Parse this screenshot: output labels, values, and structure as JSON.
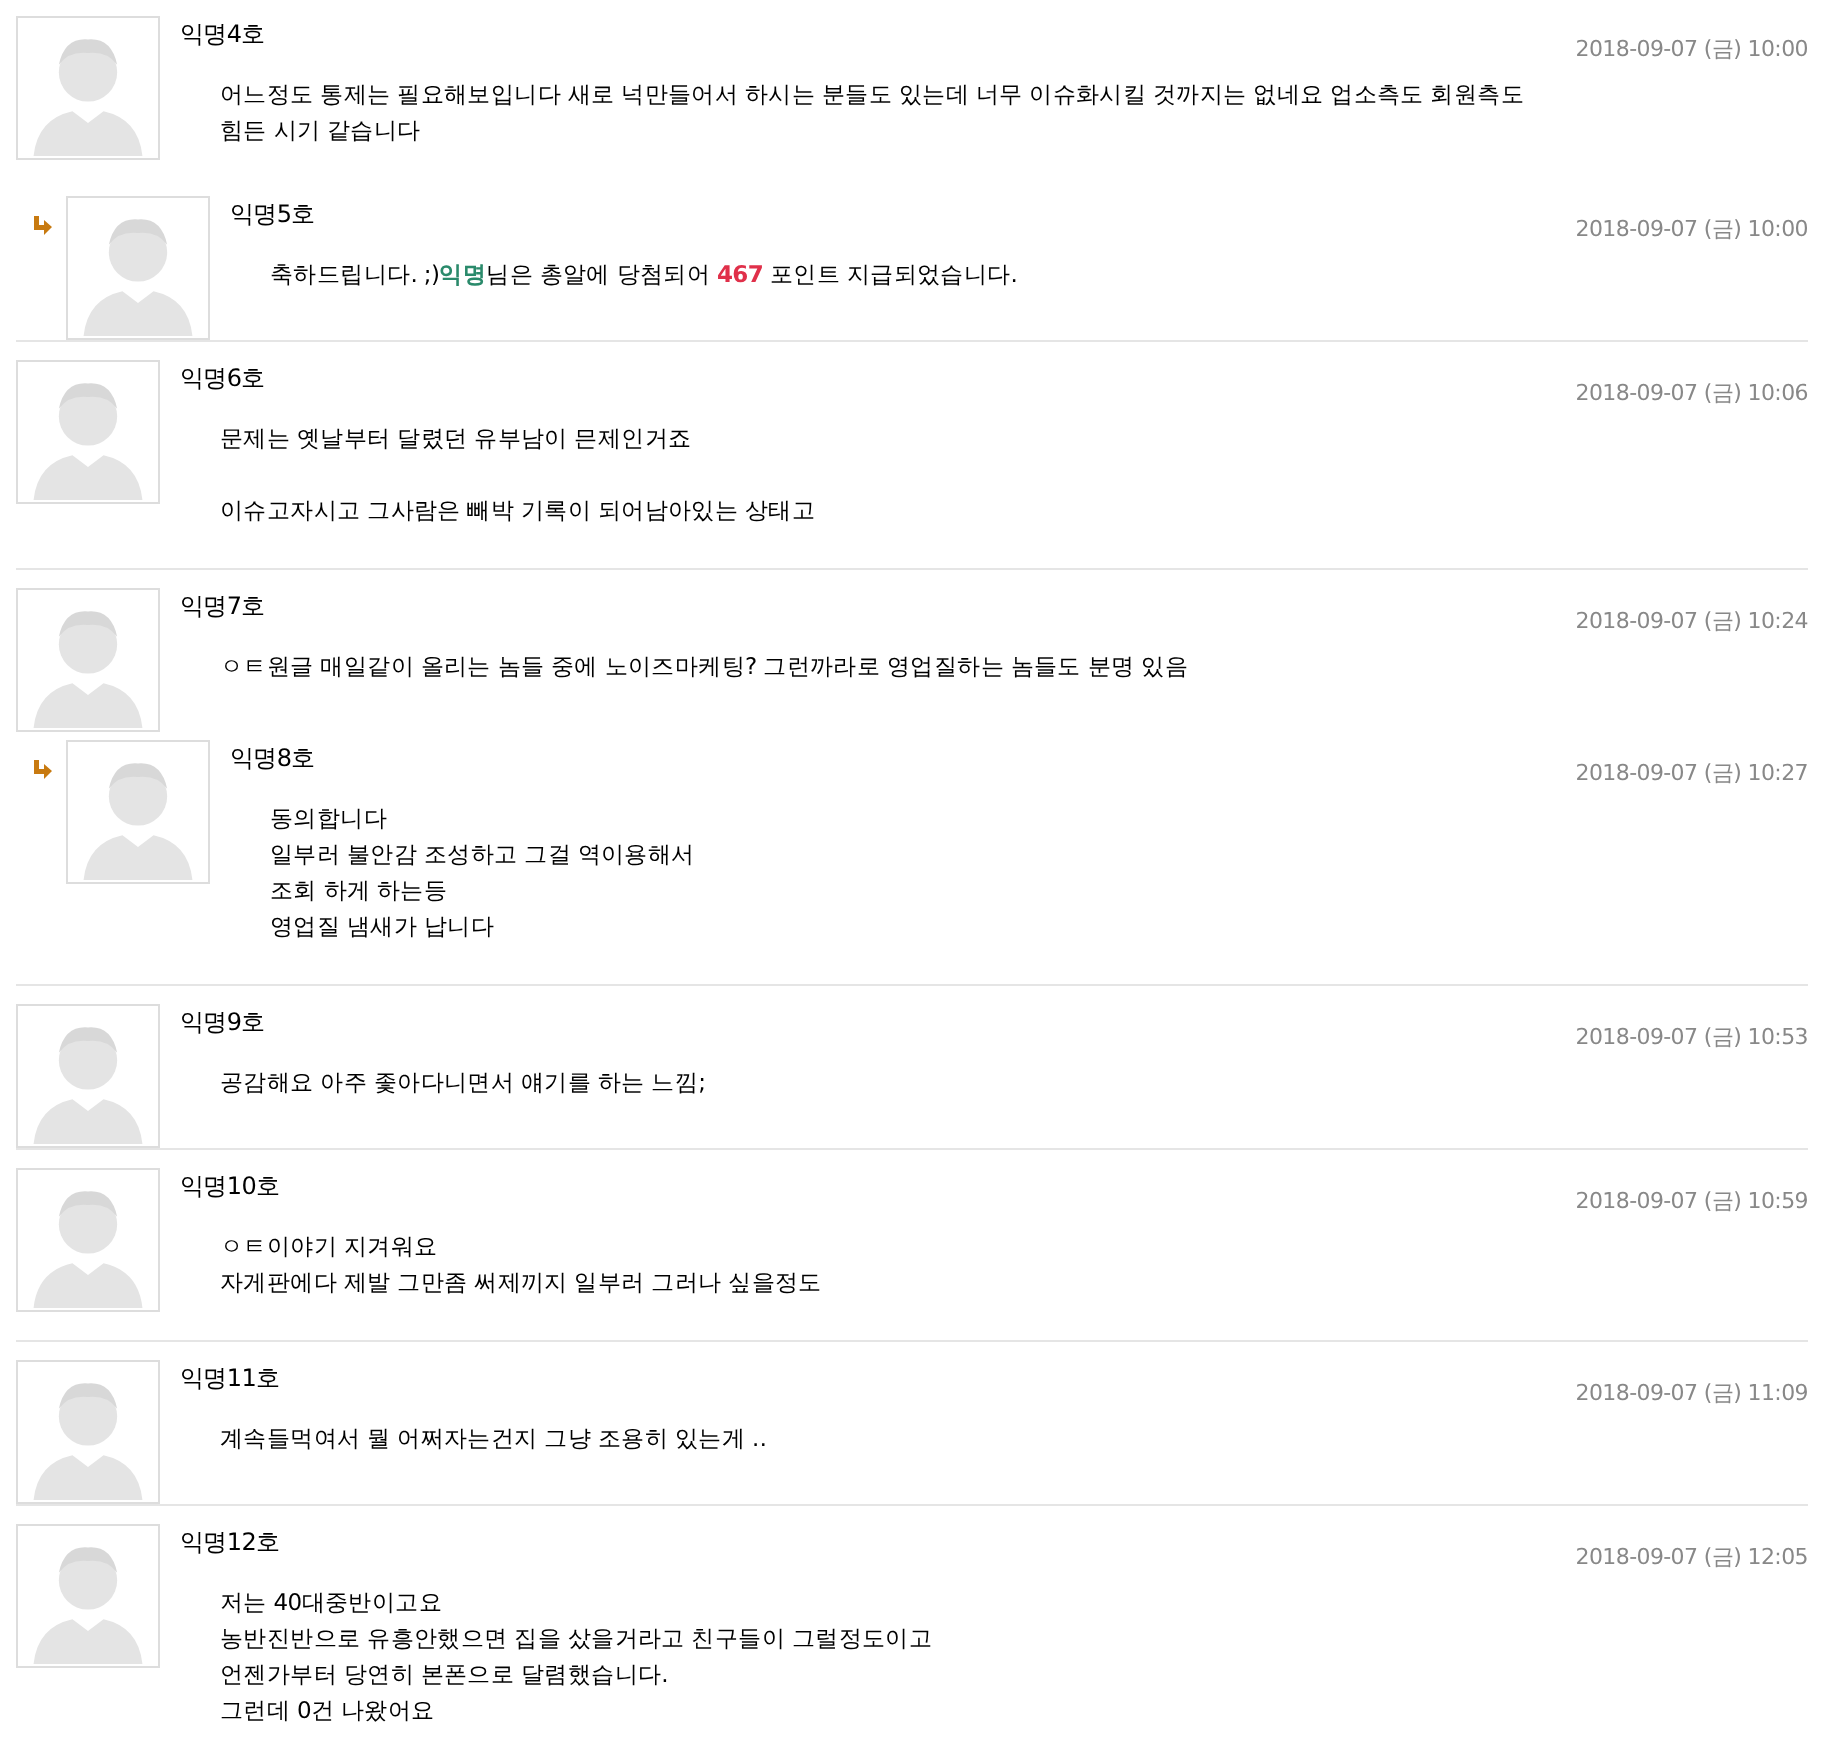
{
  "comments": [
    {
      "author": "익명4호",
      "date": "2018-09-07 (금) 10:00",
      "reply": false,
      "paragraphs": [
        [
          "어느정도 통제는 필요해보입니다 새로 넉만들어서 하시는 분들도 있는데 너무 이슈화시킬 것까지는 없네요 업소측도 회원측도 힘든 시기 같습니다"
        ]
      ]
    },
    {
      "author": "익명5호",
      "date": "2018-09-07 (금) 10:00",
      "reply": true,
      "segments": [
        {
          "kind": "plain",
          "text": "축하드립니다. ;)"
        },
        {
          "kind": "name",
          "text": "익명"
        },
        {
          "kind": "plain",
          "text": "님은 총알에 당첨되어 "
        },
        {
          "kind": "points",
          "text": "467"
        },
        {
          "kind": "plain",
          "text": " 포인트 지급되었습니다."
        }
      ]
    },
    {
      "author": "익명6호",
      "date": "2018-09-07 (금) 10:06",
      "reply": false,
      "paragraphs": [
        [
          "문제는 옛날부터 달렸던 유부남이 믄제인거죠"
        ],
        [
          "이슈고자시고 그사람은 빼박 기록이 되어남아있는 상태고"
        ]
      ]
    },
    {
      "author": "익명7호",
      "date": "2018-09-07 (금) 10:24",
      "reply": false,
      "paragraphs": [
        [
          "ㅇㅌ원글 매일같이 올리는 놈들 중에 노이즈마케팅? 그런까라로 영업질하는 놈들도 분명 있음"
        ]
      ]
    },
    {
      "author": "익명8호",
      "date": "2018-09-07 (금) 10:27",
      "reply": true,
      "paragraphs": [
        [
          "동의합니다",
          "일부러 불안감 조성하고 그걸 역이용해서",
          "조회 하게 하는등",
          "영업질 냄새가 납니다"
        ]
      ]
    },
    {
      "author": "익명9호",
      "date": "2018-09-07 (금) 10:53",
      "reply": false,
      "paragraphs": [
        [
          "공감해요 아주 좇아다니면서 얘기를 하는 느낌;"
        ]
      ]
    },
    {
      "author": "익명10호",
      "date": "2018-09-07 (금) 10:59",
      "reply": false,
      "paragraphs": [
        [
          "ㅇㅌ이야기 지겨워요",
          "자게판에다 제발 그만좀 써제끼지 일부러 그러나 싶을정도"
        ]
      ]
    },
    {
      "author": "익명11호",
      "date": "2018-09-07 (금) 11:09",
      "reply": false,
      "paragraphs": [
        [
          "계속들먹여서 뭘 어쩌자는건지 그냥 조용히 있는게 ‥"
        ]
      ]
    },
    {
      "author": "익명12호",
      "date": "2018-09-07 (금) 12:05",
      "reply": false,
      "paragraphs": [
        [
          "저는 40대중반이고요",
          "농반진반으로 유흥안했으면 집을 샀을거라고 친구들이 그럴정도이고",
          "언젠가부터 당연히 본폰으로 달렴했습니다.",
          "그런데 0건 나왔어요"
        ]
      ]
    }
  ]
}
